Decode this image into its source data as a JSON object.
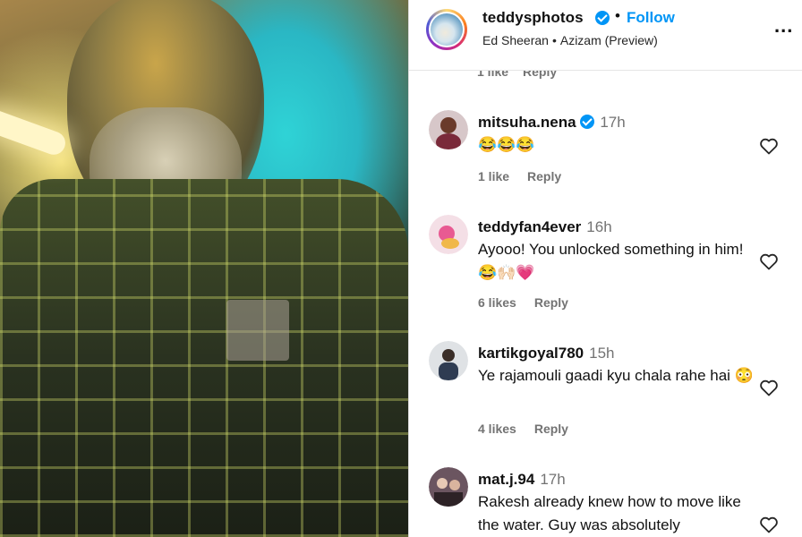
{
  "post": {
    "username": "teddysphotos",
    "follow_label": "Follow",
    "audio_artist": "Ed Sheeran",
    "audio_title": "Azizam (Preview)",
    "more_label": "...",
    "media_description_icon": "video-frame"
  },
  "previous_meta": {
    "likes": "1 like",
    "reply": "Reply"
  },
  "comments": [
    {
      "username": "mitsuha.nena",
      "verified": true,
      "time": "17h",
      "text": "😂😂😂",
      "likes": "1 like",
      "reply": "Reply",
      "avatar_colors": [
        "#d7c7c9",
        "#7a2a3a"
      ]
    },
    {
      "username": "teddyfan4ever",
      "verified": false,
      "time": "16h",
      "text": "Ayooo! You unlocked something in him! 😂🙌🏻💗",
      "likes": "6 likes",
      "reply": "Reply",
      "avatar_colors": [
        "#f4dfe6",
        "#e85a92"
      ]
    },
    {
      "username": "kartikgoyal780",
      "verified": false,
      "time": "15h",
      "text": "Ye rajamouli gaadi kyu chala rahe hai 😳",
      "likes": "4 likes",
      "reply": "Reply",
      "avatar_colors": [
        "#dfe2e5",
        "#2f3c52"
      ]
    },
    {
      "username": "mat.j.94",
      "verified": false,
      "time": "17h",
      "text": "Rakesh already knew how to move like the water. Guy was absolutely",
      "likes": "",
      "reply": "",
      "avatar_colors": [
        "#6b5560",
        "#2d2226"
      ]
    }
  ],
  "icons": {
    "heart": "heart-outline-icon",
    "verified": "verified-badge-icon",
    "more": "more-horizontal-icon"
  },
  "colors": {
    "follow_blue": "#0095f6",
    "verified_blue": "#0095f6",
    "meta_gray": "#737373"
  }
}
